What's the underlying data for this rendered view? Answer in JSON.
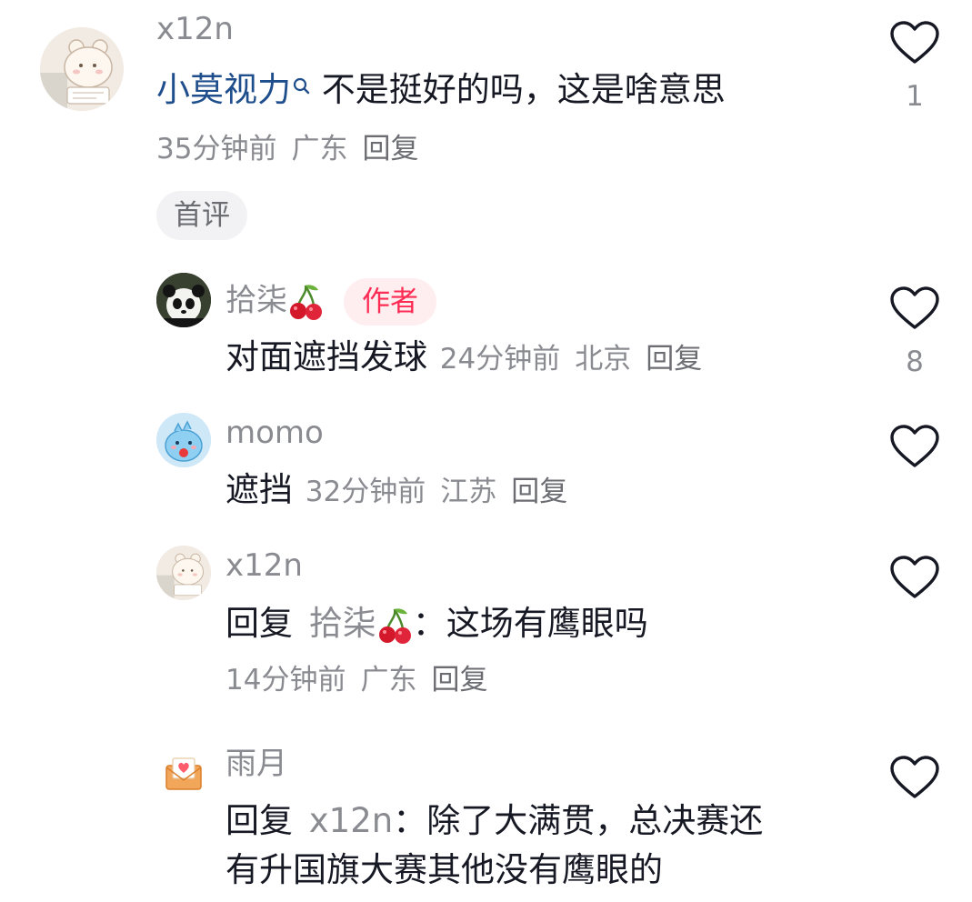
{
  "comments": [
    {
      "username": "x12n",
      "content_link": "小莫视力",
      "content_rest": " 不是挺好的吗，这是啥意思",
      "time": "35分钟前",
      "location": "广东",
      "reply_label": "回复",
      "likes": "1",
      "first_badge": "首评",
      "avatar_icon": "bear-avatar-icon"
    },
    {
      "username": "拾柒",
      "author_badge": "作者",
      "content": "对面遮挡发球",
      "time": "24分钟前",
      "location": "北京",
      "reply_label": "回复",
      "likes": "8",
      "avatar_icon": "panda-avatar-icon",
      "username_emoji": "cherry-icon"
    },
    {
      "username": "momo",
      "content": "遮挡",
      "time": "32分钟前",
      "location": "江苏",
      "reply_label": "回复",
      "likes": "",
      "avatar_icon": "blue-creature-avatar-icon"
    },
    {
      "username": "x12n",
      "reply_prefix": "回复",
      "reply_target": "拾柒",
      "content": "：这场有鹰眼吗",
      "time": "14分钟前",
      "location": "广东",
      "reply_label": "回复",
      "likes": "",
      "avatar_icon": "bear-avatar-icon"
    },
    {
      "username": "雨月",
      "reply_prefix": "回复",
      "reply_target": "x12n",
      "content_line1": "：除了大满贯，总决赛还",
      "content_line2": "有升国旗大赛其他没有鹰眼的",
      "likes": "",
      "avatar_icon": "envelope-heart-avatar-icon"
    }
  ],
  "colors": {
    "text": "#161823",
    "muted": "#8a8b91",
    "link": "#1f4e8c",
    "author_badge": "#fe2c55",
    "author_badge_bg": "#ffeef0"
  }
}
